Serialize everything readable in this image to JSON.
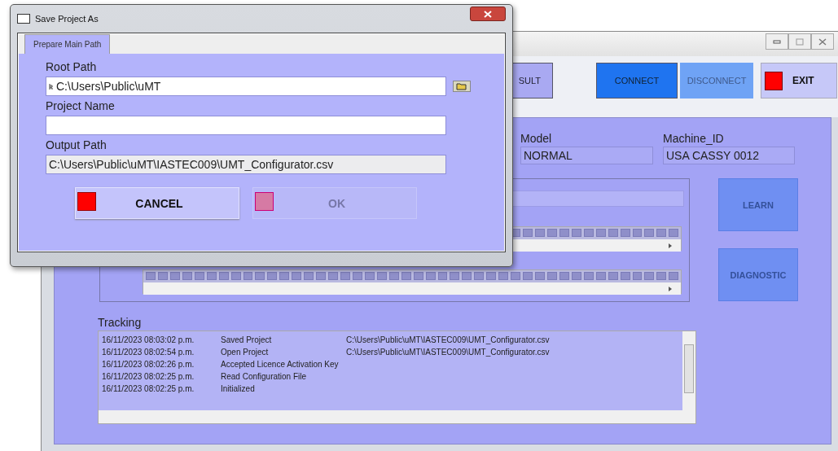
{
  "main_window": {
    "toolbar": [
      {
        "label": "SULT",
        "kind": "plain",
        "disabled": false
      },
      {
        "label": "CONNECT",
        "kind": "primary",
        "disabled": false
      },
      {
        "label": "DISCONNECT",
        "kind": "primary",
        "disabled": true
      },
      {
        "label": "EXIT",
        "kind": "stop",
        "disabled": false
      }
    ],
    "info_fields": [
      {
        "label": "Model",
        "value": "NORMAL"
      },
      {
        "label": "Machine_ID",
        "value": "USA CASSY 0012"
      }
    ],
    "side_buttons": [
      {
        "label": "LEARN"
      },
      {
        "label": "DIAGNOSTIC"
      }
    ],
    "tracking": {
      "label": "Tracking",
      "rows": [
        {
          "time": "16/11/2023 08:03:02 p.m.",
          "event": "Saved Project",
          "path": "C:\\Users\\Public\\uMT\\IASTEC009\\UMT_Configurator.csv"
        },
        {
          "time": "16/11/2023 08:02:54 p.m.",
          "event": "Open Project",
          "path": "C:\\Users\\Public\\uMT\\IASTEC009\\UMT_Configurator.csv"
        },
        {
          "time": "16/11/2023 08:02:26 p.m.",
          "event": "Accepted Licence Activation Key"
        },
        {
          "time": "16/11/2023 08:02:25 p.m.",
          "event": "Read Configuration File"
        },
        {
          "time": "16/11/2023 08:02:25 p.m.",
          "event": "Initialized"
        }
      ]
    }
  },
  "dialog": {
    "title": "Save Project As",
    "tabs": [
      {
        "label": "Prepare Main Path",
        "selected": true
      }
    ],
    "root_path": {
      "label": "Root Path",
      "value": "C:\\Users\\Public\\uMT"
    },
    "project_name": {
      "label": "Project Name"
    },
    "output_path": {
      "label": "Output Path",
      "value": "C:\\Users\\Public\\uMT\\IASTEC009\\UMT_Configurator.csv",
      "readonly": true
    },
    "buttons": [
      {
        "label": "CANCEL",
        "disabled": false
      },
      {
        "label": "OK",
        "disabled": true
      }
    ]
  }
}
